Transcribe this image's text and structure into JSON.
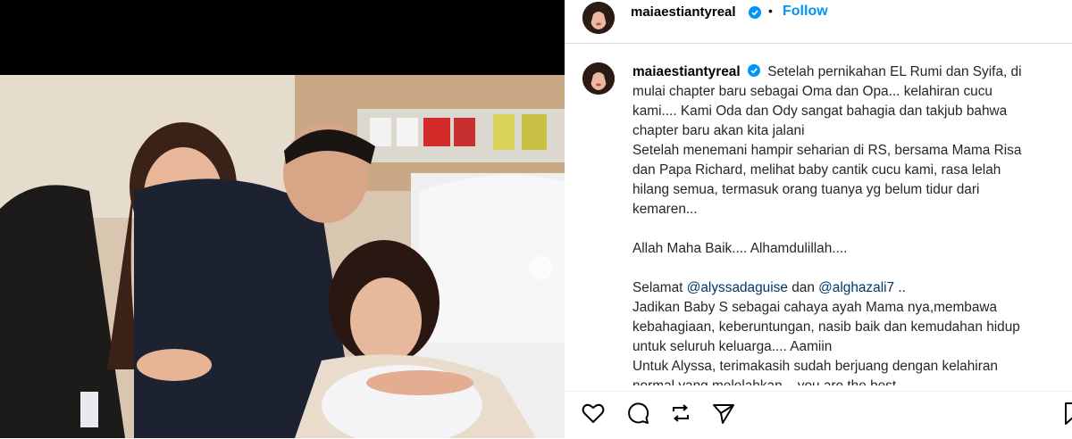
{
  "post": {
    "username": "maiaestiantyreal",
    "separator": "•",
    "follow_label": "Follow"
  },
  "caption": {
    "username": "maiaestiantyreal",
    "line1_text": "Setelah pernikahan EL Rumi dan Syifa, di",
    "line2": "mulai chapter baru sebagai Oma dan Opa... kelahiran cucu",
    "line3": "kami.... Kami Oda dan Ody sangat bahagia dan takjub bahwa",
    "line4": "chapter baru akan kita jalani",
    "line5": "Setelah menemani hampir seharian di RS, bersama Mama Risa",
    "line6": "dan Papa Richard, melihat baby cantik cucu kami, rasa lelah",
    "line7": "hilang semua, termasuk orang tuanya yg belum tidur dari",
    "line8": "kemaren...",
    "line9": "Allah Maha Baik.... Alhamdulillah....",
    "line10_prefix": "Selamat ",
    "mention1": "@alyssadaguise",
    "line10_mid": " dan ",
    "mention2": "@alghazali7",
    "line10_suffix": " ..",
    "line11": "Jadikan Baby S sebagai cahaya ayah Mama nya,membawa",
    "line12": "kebahagiaan, keberuntungan, nasib baik dan kemudahan hidup",
    "line13": "untuk seluruh keluarga.... Aamiin",
    "line14": "Untuk Alyssa, terimakasih sudah berjuang dengan kelahiran",
    "line15": "normal yang melelahkan... you are the best"
  },
  "actions": {
    "like_icon": "heart-outline",
    "comment_icon": "speech-bubble",
    "share_icon": "paper-plane",
    "repost_icon": "repost-arrows",
    "save_icon": "bookmark"
  },
  "colors": {
    "link": "#0095f6",
    "mention": "#00376b",
    "verified": "#0095f6"
  }
}
